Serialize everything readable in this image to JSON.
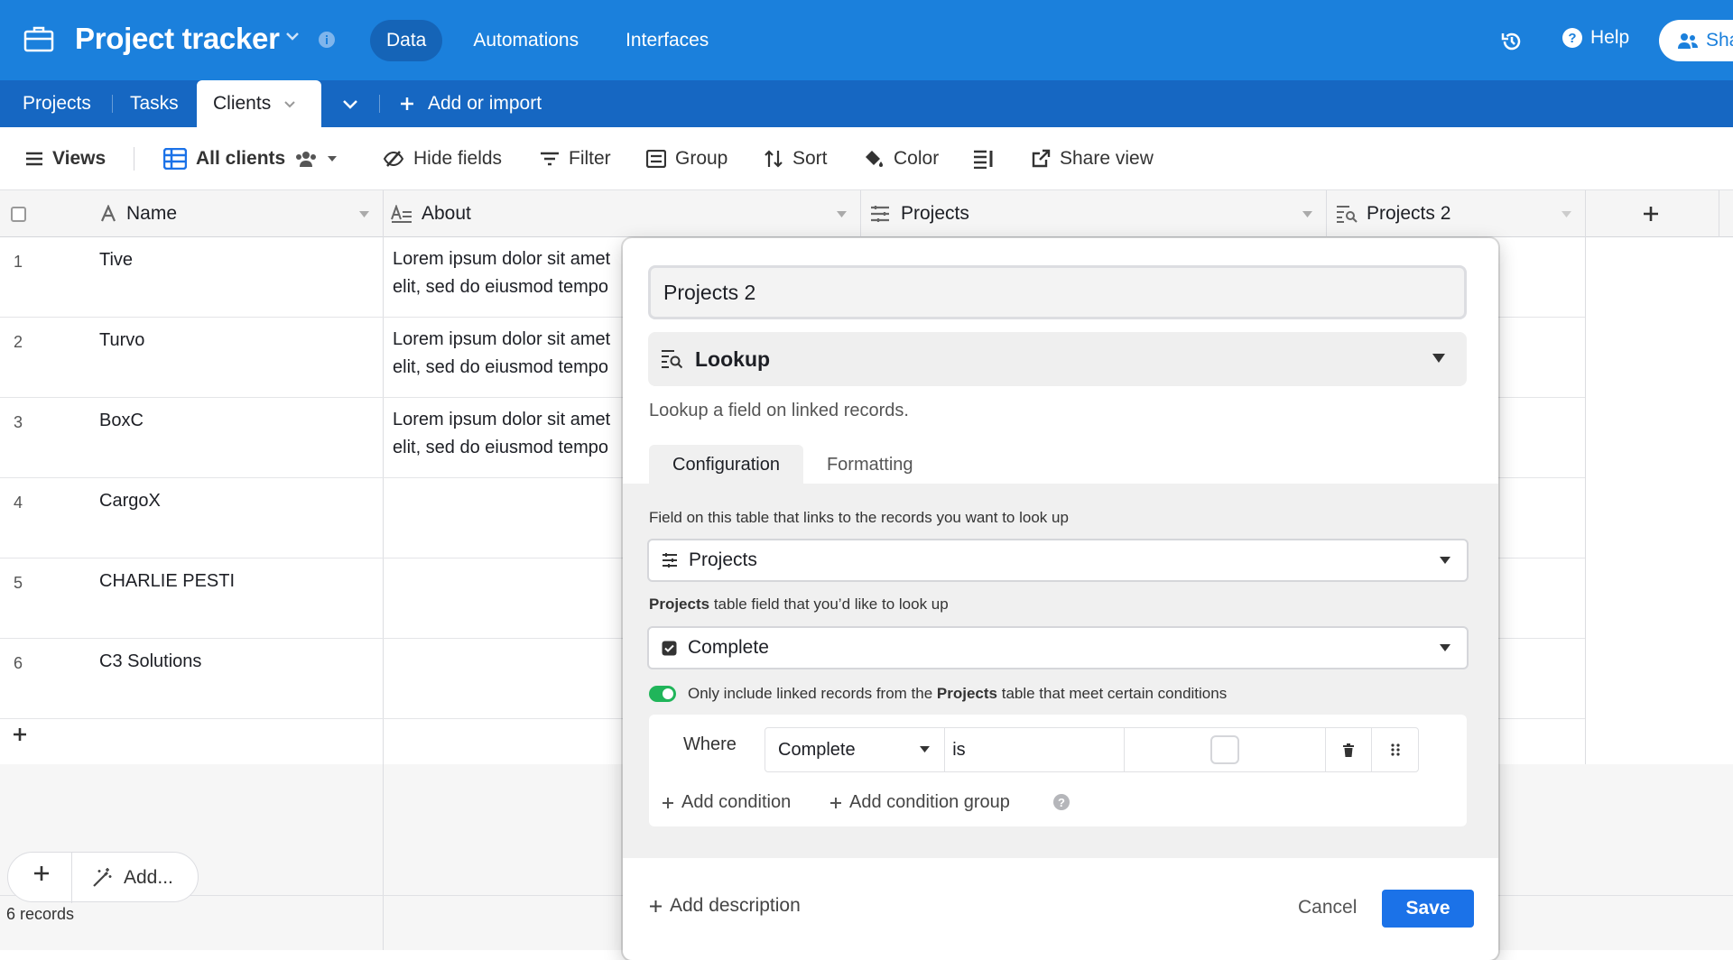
{
  "colors": {
    "topbar": "#1b80dc",
    "tabbar": "#1667c2",
    "accent": "#1b72e8",
    "toggle_on": "#20b55a"
  },
  "header": {
    "title": "Project tracker",
    "nav": [
      "Data",
      "Automations",
      "Interfaces"
    ],
    "help_label": "Help",
    "share_label": "Sha"
  },
  "tables": {
    "items": [
      "Projects",
      "Tasks",
      "Clients"
    ],
    "add_label": "Add or import"
  },
  "toolbar": {
    "views": "Views",
    "view_name": "All clients",
    "hide_fields": "Hide fields",
    "filter": "Filter",
    "group": "Group",
    "sort": "Sort",
    "color": "Color",
    "share_view": "Share view"
  },
  "grid": {
    "columns": [
      "Name",
      "About",
      "Projects",
      "Projects 2"
    ],
    "rows": [
      {
        "num": "1",
        "name": "Tive",
        "about1": "Lorem ipsum dolor sit amet",
        "about2": "elit, sed do eiusmod tempo"
      },
      {
        "num": "2",
        "name": "Turvo",
        "about1": "Lorem ipsum dolor sit amet",
        "about2": "elit, sed do eiusmod tempo"
      },
      {
        "num": "3",
        "name": "BoxC",
        "about1": "Lorem ipsum dolor sit amet",
        "about2": "elit, sed do eiusmod tempo"
      },
      {
        "num": "4",
        "name": "CargoX",
        "about1": "",
        "about2": ""
      },
      {
        "num": "5",
        "name": "CHARLIE PESTI",
        "about1": "",
        "about2": ""
      },
      {
        "num": "6",
        "name": "C3 Solutions",
        "about1": "",
        "about2": ""
      }
    ],
    "add_label": "Add...",
    "records": "6 records"
  },
  "modal": {
    "field_name": "Projects 2",
    "field_type": "Lookup",
    "type_description": "Lookup a field on linked records.",
    "tabs": [
      "Configuration",
      "Formatting"
    ],
    "link_label": "Field on this table that links to the records you want to look up",
    "link_value": "Projects",
    "lookup_label_bold": "Projects",
    "lookup_label_rest": " table field that you’d like to look up",
    "lookup_value": "Complete",
    "toggle_pre": "Only include linked records from the ",
    "toggle_bold": "Projects",
    "toggle_post": " table that meet certain conditions",
    "where": "Where",
    "cond_field": "Complete",
    "cond_op": "is",
    "add_condition": "Add condition",
    "add_condition_group": "Add condition group",
    "add_description": "Add description",
    "cancel": "Cancel",
    "save": "Save"
  }
}
